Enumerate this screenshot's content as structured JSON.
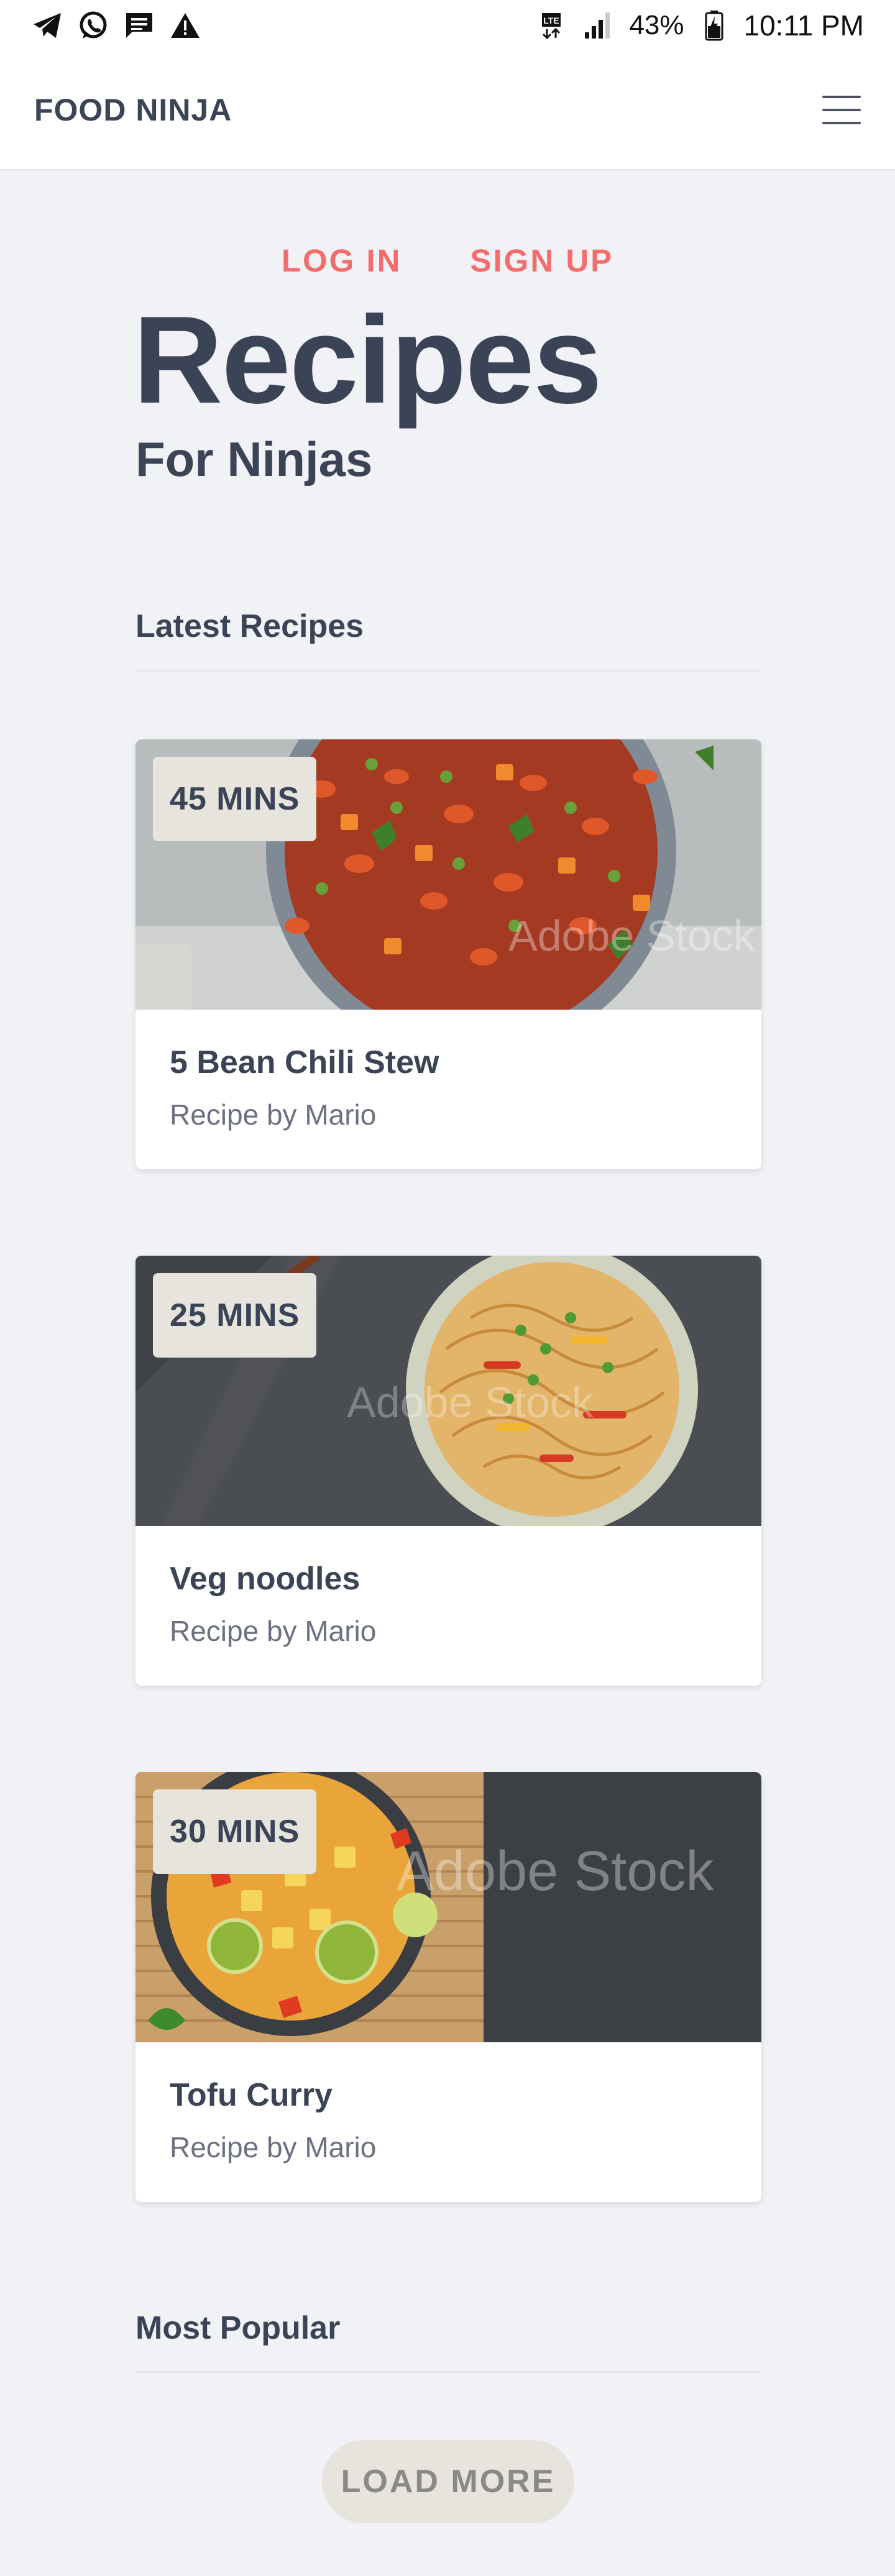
{
  "status_bar": {
    "battery": "43%",
    "time": "10:11 PM",
    "left_icons": [
      "telegram-icon",
      "whatsapp-icon",
      "message-icon",
      "warning-icon"
    ],
    "right_icons": [
      "lte-icon",
      "signal-icon",
      "battery-icon"
    ]
  },
  "nav": {
    "brand": "FOOD NINJA",
    "menu_icon": "hamburger-menu-icon"
  },
  "auth": {
    "login": "LOG IN",
    "signup": "SIGN UP"
  },
  "hero": {
    "title": "Recipes",
    "subtitle": "For Ninjas"
  },
  "latest": {
    "heading": "Latest Recipes",
    "recipes": [
      {
        "time": "45 MINS",
        "title": "5 Bean Chili Stew",
        "author": "Recipe by Mario",
        "watermark": "Adobe Stock"
      },
      {
        "time": "25 MINS",
        "title": "Veg noodles",
        "author": "Recipe by Mario",
        "watermark": "Adobe Stock"
      },
      {
        "time": "30 MINS",
        "title": "Tofu Curry",
        "author": "Recipe by Mario",
        "watermark": "Adobe Stock"
      }
    ]
  },
  "popular": {
    "heading": "Most Popular"
  },
  "load_more": "LOAD MORE",
  "colors": {
    "accent": "#f66b6b",
    "text": "#3b4456",
    "badge": "#e6e4dc",
    "background": "#f0f2f5"
  }
}
